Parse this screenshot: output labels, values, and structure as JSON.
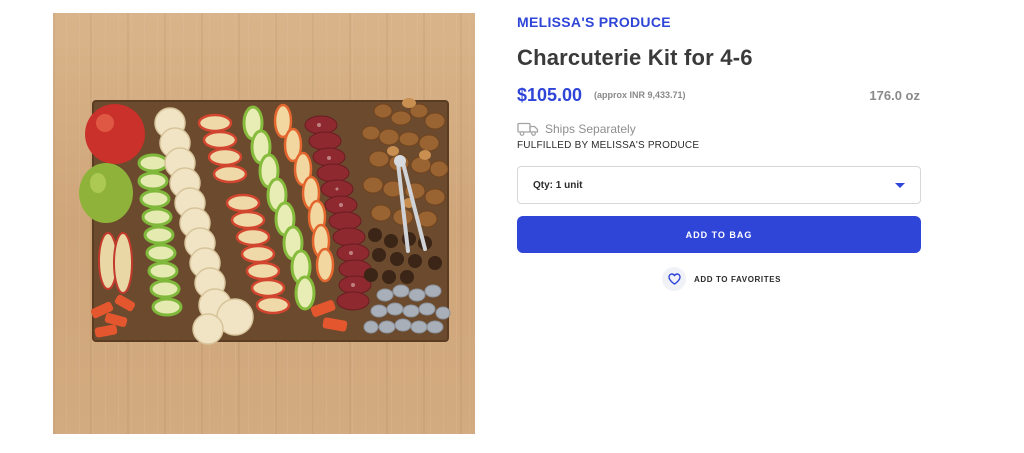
{
  "product": {
    "brand": "MELISSA'S PRODUCE",
    "title": "Charcuterie Kit for 4-6",
    "price": "$105.00",
    "approx_price": "(approx INR 9,433.71)",
    "weight": "176.0 oz",
    "shipping_note": "Ships Separately",
    "fulfilled_by": "FULFILLED BY MELISSA'S PRODUCE"
  },
  "quantity": {
    "selected": "Qty: 1 unit"
  },
  "actions": {
    "add_to_bag": "ADD TO BAG",
    "add_to_favorites": "ADD TO FAVORITES"
  },
  "icons": {
    "truck": "truck-icon",
    "heart": "heart-icon",
    "zoom": "zoom-icon",
    "dropdown": "chevron-down-icon"
  },
  "colors": {
    "accent": "#2f45d8",
    "muted_text": "#8a8a8a",
    "title_text": "#3a3a3a"
  }
}
